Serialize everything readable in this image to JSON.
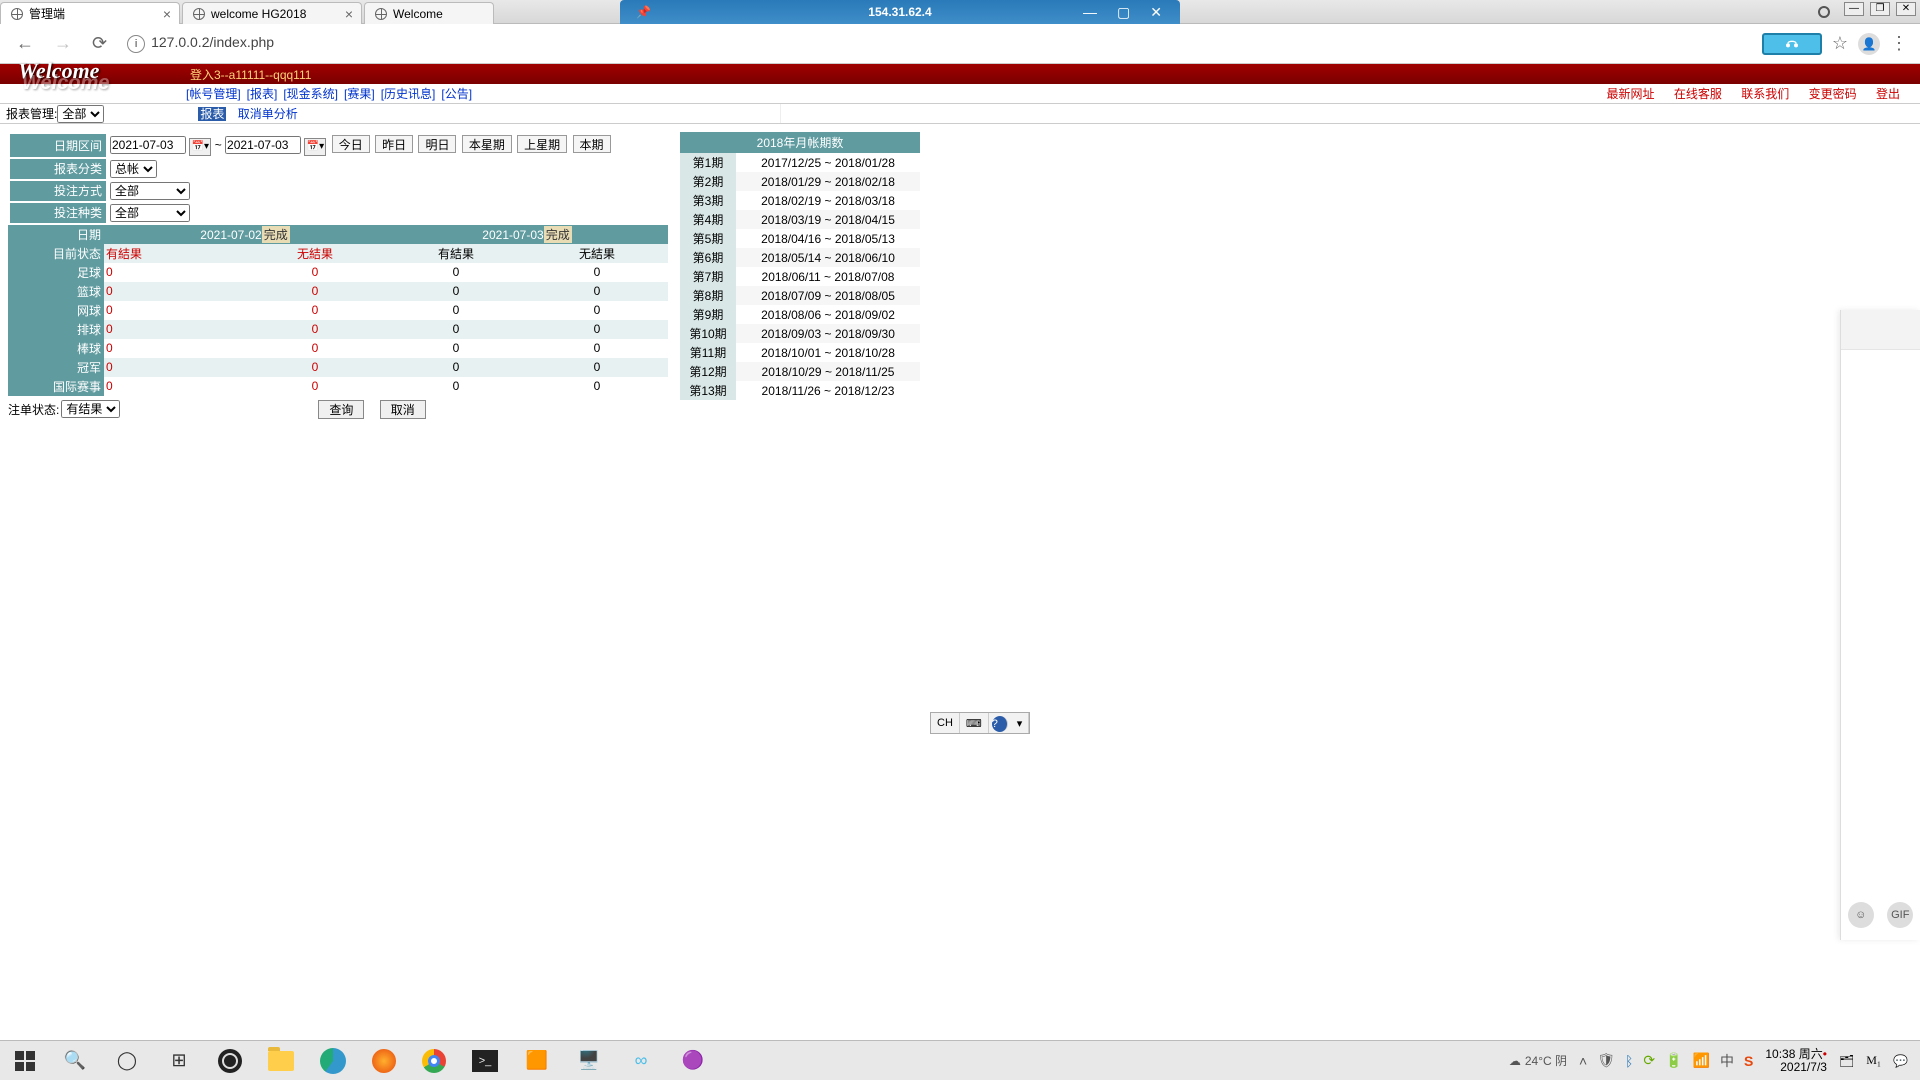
{
  "win_title_ip": "154.31.62.4",
  "tabs": {
    "t1": "管理端",
    "t2": "welcome HG2018",
    "t3": "Welcome"
  },
  "url": "127.0.0.2/index.php",
  "login_info": "登入3--a11111--qqq111",
  "menu": {
    "m1": "[帐号管理]",
    "m2": "[报表]",
    "m3": "[现金系统]",
    "m4": "[赛果]",
    "m5": "[历史讯息]",
    "m6": "[公告]"
  },
  "right_links": {
    "r1": "最新网址",
    "r2": "在线客服",
    "r3": "联系我们",
    "r4": "变更密码",
    "r5": "登出"
  },
  "subbar": {
    "label": "报表管理:",
    "sel": "全部",
    "lnk1": "报表",
    "lnk2": "取消单分析"
  },
  "filters": {
    "date_label": "日期区间",
    "date_from": "2021-07-03",
    "tilde": "~",
    "date_to": "2021-07-03",
    "btns": {
      "today": "今日",
      "yest": "昨日",
      "tom": "明日",
      "thisw": "本星期",
      "lastw": "上星期",
      "thisp": "本期"
    },
    "cat_label": "报表分类",
    "cat_sel": "总帐",
    "method_label": "投注方式",
    "method_sel": "全部",
    "type_label": "投注种类",
    "type_sel": "全部"
  },
  "grid": {
    "date_hdr": "日期",
    "d1": "2021-07-02",
    "d2": "2021-07-03",
    "done": "完成",
    "status_hdr": "目前状态",
    "has": "有結果",
    "none": "无結果",
    "rows": [
      "足球",
      "篮球",
      "网球",
      "排球",
      "棒球",
      "冠军",
      "国际赛事"
    ]
  },
  "footer": {
    "label": "注单状态:",
    "sel": "有结果",
    "ok": "查询",
    "cancel": "取消"
  },
  "periods": {
    "title": "2018年月帐期数",
    "rows": [
      {
        "n": "第1期",
        "r": "2017/12/25 ~ 2018/01/28"
      },
      {
        "n": "第2期",
        "r": "2018/01/29 ~ 2018/02/18"
      },
      {
        "n": "第3期",
        "r": "2018/02/19 ~ 2018/03/18"
      },
      {
        "n": "第4期",
        "r": "2018/03/19 ~ 2018/04/15"
      },
      {
        "n": "第5期",
        "r": "2018/04/16 ~ 2018/05/13"
      },
      {
        "n": "第6期",
        "r": "2018/05/14 ~ 2018/06/10"
      },
      {
        "n": "第7期",
        "r": "2018/06/11 ~ 2018/07/08"
      },
      {
        "n": "第8期",
        "r": "2018/07/09 ~ 2018/08/05"
      },
      {
        "n": "第9期",
        "r": "2018/08/06 ~ 2018/09/02"
      },
      {
        "n": "第10期",
        "r": "2018/09/03 ~ 2018/09/30"
      },
      {
        "n": "第11期",
        "r": "2018/10/01 ~ 2018/10/28"
      },
      {
        "n": "第12期",
        "r": "2018/10/29 ~ 2018/11/25"
      },
      {
        "n": "第13期",
        "r": "2018/11/26 ~ 2018/12/23"
      }
    ]
  },
  "ime": {
    "ch": "CH"
  },
  "weather": "24°C 阴",
  "clock": {
    "t": "10:38",
    "d": "周六",
    "date": "2021/7/3"
  }
}
